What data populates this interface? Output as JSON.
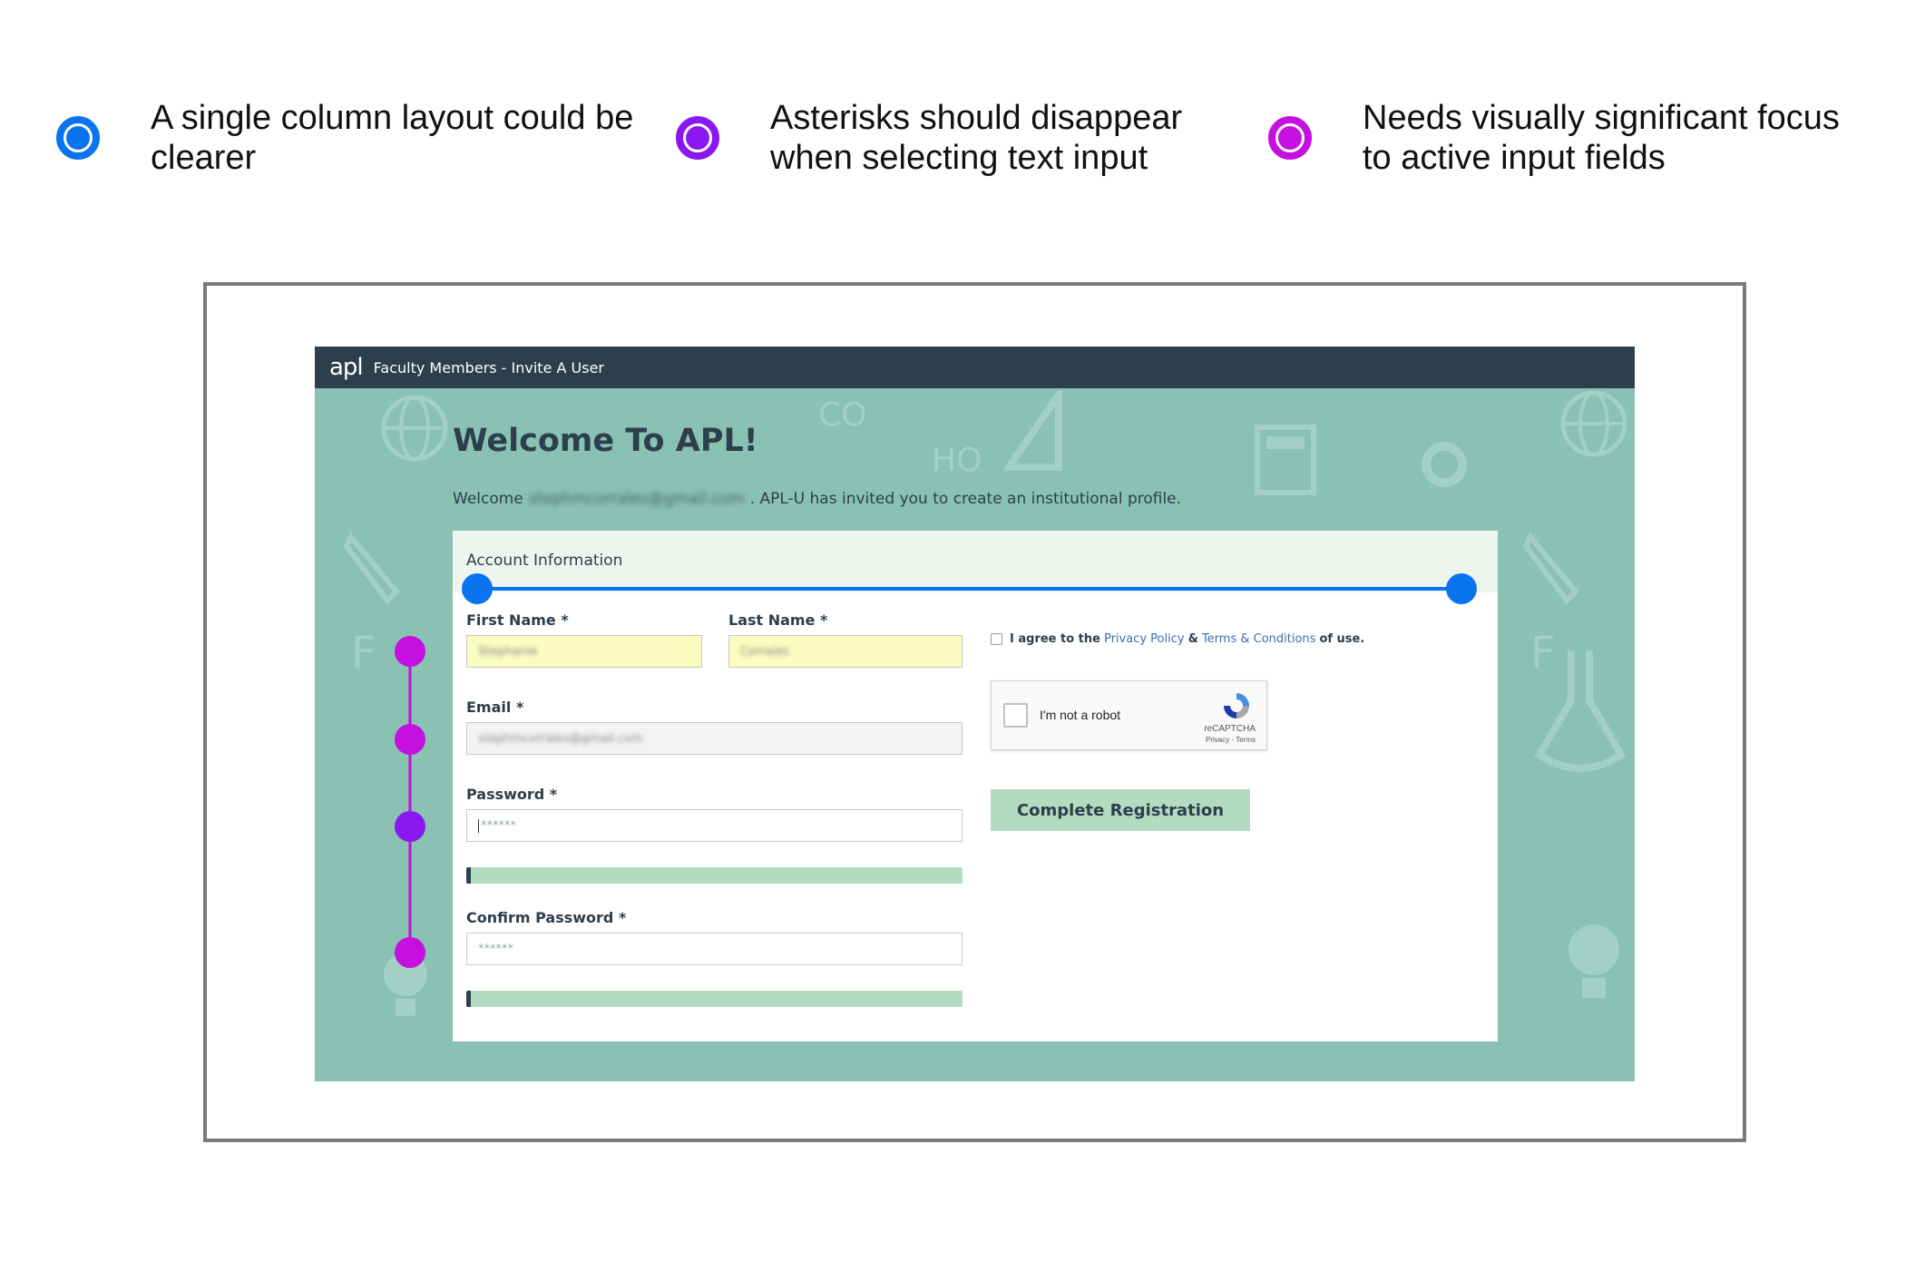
{
  "legend": [
    {
      "text": "A single column layout could be clearer",
      "color": "#0a74f0",
      "icon": "blue-target-marker"
    },
    {
      "text": "Asterisks should disappear when selecting text input",
      "color": "#8a17f0",
      "icon": "violet-target-marker"
    },
    {
      "text": "Needs visually significant focus to active input fields",
      "color": "#c510e0",
      "icon": "magenta-target-marker"
    }
  ],
  "app": {
    "logo": "apl",
    "title": "Faculty Members - Invite A User",
    "heading": "Welcome To APL!",
    "welcome_prefix": "Welcome",
    "welcome_email": "stephmcorrales@gmail.com",
    "welcome_suffix": ". APL-U has invited you to create an institutional profile."
  },
  "form": {
    "section_title": "Account Information",
    "first_name": {
      "label": "First Name *",
      "value": "Stephanie"
    },
    "last_name": {
      "label": "Last Name *",
      "value": "Corrales"
    },
    "email": {
      "label": "Email *",
      "value": "stephmcorrales@gmail.com"
    },
    "password": {
      "label": "Password *",
      "placeholder": "******"
    },
    "confirm_password": {
      "label": "Confirm Password *",
      "placeholder": "******"
    },
    "agree_prefix": "I agree to the",
    "privacy_link": "Privacy Policy",
    "amp": "&",
    "terms_link": "Terms & Conditions",
    "agree_suffix": "of use.",
    "recaptcha": {
      "label": "I'm not a robot",
      "brand": "reCAPTCHA",
      "terms": "Privacy - Terms"
    },
    "submit_label": "Complete Registration"
  },
  "colors": {
    "blue": "#0a74f0",
    "violet": "#8a17f0",
    "magenta": "#c510e0",
    "topbar": "#2d3e4d",
    "background": "#89c1b3",
    "button": "#b3dbc0"
  }
}
